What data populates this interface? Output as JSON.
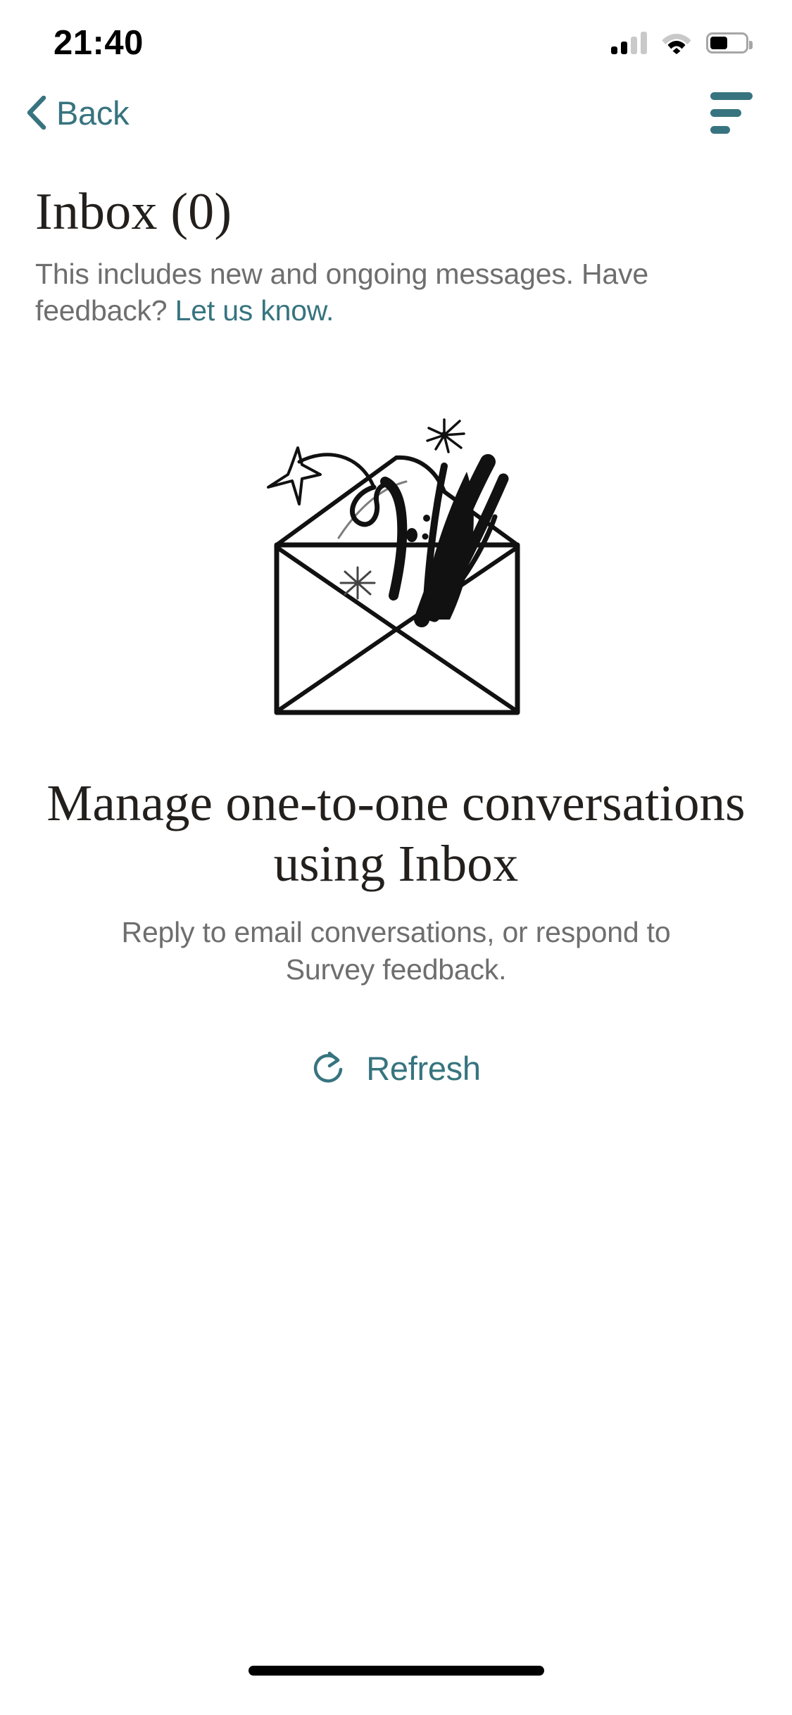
{
  "status_bar": {
    "time": "21:40",
    "cellular_icon": "cellular-signal-icon",
    "cellular_bars_filled": 2,
    "cellular_bars_total": 4,
    "wifi_icon": "wifi-icon",
    "battery_icon": "battery-icon",
    "battery_level_percent": 40
  },
  "nav_bar": {
    "back_label": "Back",
    "back_icon": "chevron-left-icon",
    "filter_icon": "filter-sort-icon"
  },
  "page_head": {
    "title": "Inbox (0)",
    "subtitle_text": "This includes new and ongoing messages. Have feedback? ",
    "subtitle_link": "Let us know."
  },
  "empty_state": {
    "illustration_name": "open-envelope-sparkles-illustration",
    "title": "Manage one-to-one conversations using Inbox",
    "body": "Reply to email conversations, or respond to Survey feedback.",
    "refresh_label": "Refresh",
    "refresh_icon": "refresh-circular-arrow-icon"
  },
  "colors": {
    "accent_teal": "#37747f",
    "text_dark": "#231f1c",
    "text_muted": "#6e6e6e",
    "background": "#ffffff"
  }
}
